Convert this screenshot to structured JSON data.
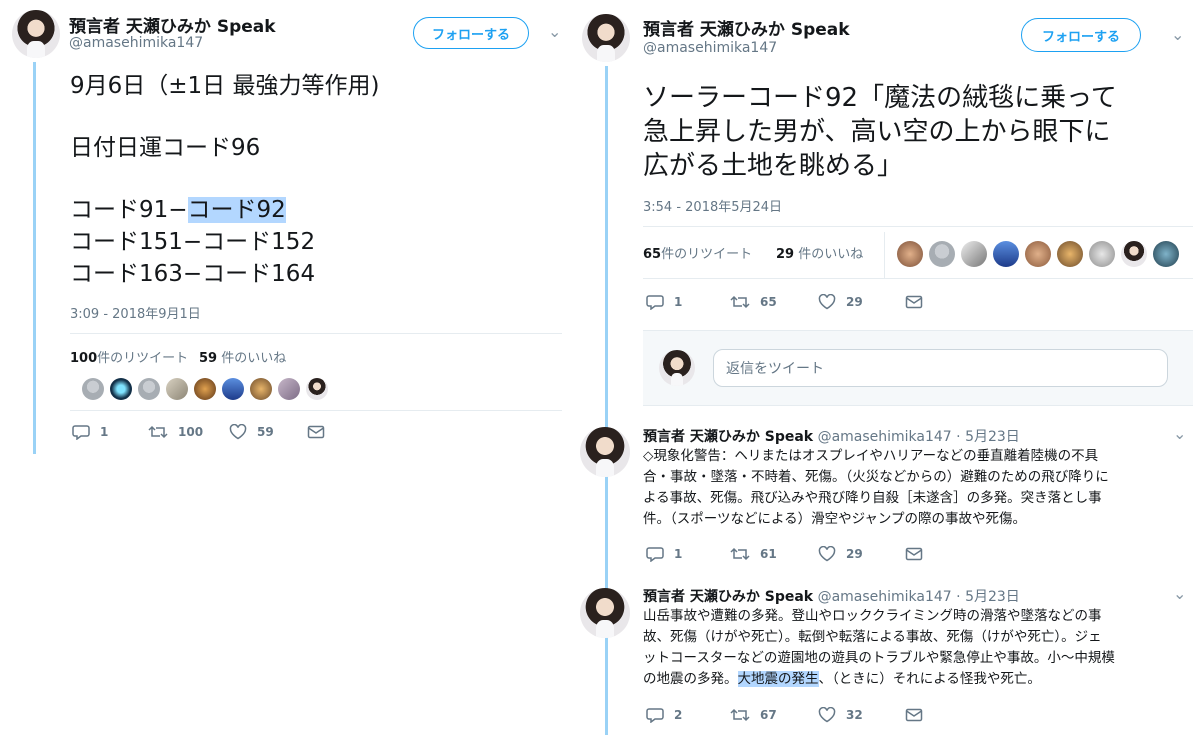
{
  "left": {
    "user": {
      "name": "預言者 天瀬ひみか Speak",
      "handle": "@amasehimika147"
    },
    "follow_label": "フォローする",
    "body": {
      "line1": "9月6日（±1日 最強力等作用)",
      "line2": "日付日運コード96",
      "line3a": "コード91−",
      "line3b": "コード92",
      "line4": "コード151−コード152",
      "line5": "コード163−コード164"
    },
    "timestamp": "3:09 - 2018年9月1日",
    "stats": {
      "retweets_num": "100",
      "retweets_label": "件のリツイート",
      "likes_num": "59",
      "likes_label": " 件のいいね"
    },
    "actions": {
      "reply": "1",
      "retweet": "100",
      "like": "59"
    }
  },
  "right": {
    "user": {
      "name": "預言者 天瀬ひみか Speak",
      "handle": "@amasehimika147"
    },
    "follow_label": "フォローする",
    "body": {
      "line1": "ソーラーコード92「魔法の絨毯に乗って",
      "line2": "急上昇した男が、高い空の上から眼下に",
      "line3": "広がる土地を眺める」"
    },
    "timestamp": "3:54 - 2018年5月24日",
    "stats": {
      "retweets_num": "65",
      "retweets_label": "件のリツイート",
      "likes_num": "29",
      "likes_label": " 件のいいね"
    },
    "actions": {
      "reply": "1",
      "retweet": "65",
      "like": "29"
    },
    "reply_placeholder": "返信をツイート",
    "replies": [
      {
        "name": "預言者 天瀬ひみか Speak",
        "handle": "@amasehimika147 · 5月23日",
        "text_lines": [
          "◇現象化警告：ヘリまたはオスプレイやハリアーなどの垂直離着陸機の不具",
          "合・事故・墜落・不時着、死傷。（火災などからの）避難のための飛び降りに",
          "よる事故、死傷。飛び込みや飛び降り自殺［未遂含］の多発。突き落とし事",
          "件。（スポーツなどによる）滑空やジャンプの際の事故や死傷。"
        ],
        "actions": {
          "reply": "1",
          "retweet": "61",
          "like": "29"
        }
      },
      {
        "name": "預言者 天瀬ひみか Speak",
        "handle": "@amasehimika147 · 5月23日",
        "text_lines": [
          "山岳事故や遭難の多発。登山やロッククライミング時の滑落や墜落などの事",
          "故、死傷（けがや死亡）。転倒や転落による事故、死傷（けがや死亡）。ジェ",
          "ットコースターなどの遊園地の遊具のトラブルや緊急停止や事故。小〜中規模",
          "の地震の多発。"
        ],
        "last_line_highlight": "大地震の発生",
        "last_line_rest": "、（ときに）それによる怪我や死亡。",
        "actions": {
          "reply": "2",
          "retweet": "67",
          "like": "32"
        }
      }
    ]
  },
  "colors": {
    "accent": "#1da1f2",
    "thread": "#9ad2f6",
    "highlight": "#b3d7ff",
    "muted": "#657786"
  }
}
